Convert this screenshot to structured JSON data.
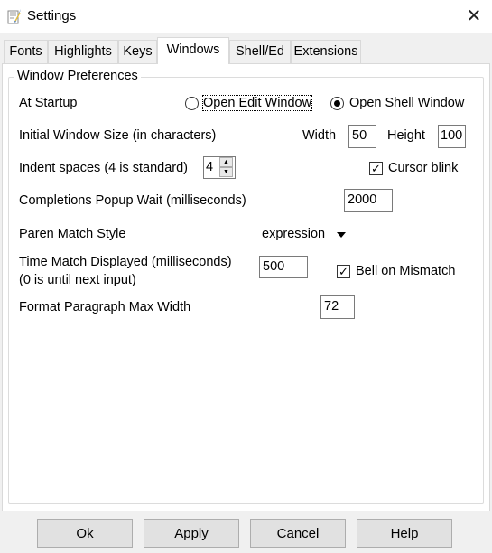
{
  "window": {
    "title": "Settings",
    "close_glyph": "✕",
    "icon": "python-feather-icon"
  },
  "tabs": [
    {
      "label": "Fonts"
    },
    {
      "label": "Highlights"
    },
    {
      "label": "Keys"
    },
    {
      "label": "Windows",
      "active": true
    },
    {
      "label": "Shell/Ed"
    },
    {
      "label": "Extensions"
    }
  ],
  "group": {
    "title": "Window Preferences",
    "startup": {
      "label": "At Startup",
      "option_edit": "Open Edit Window",
      "option_shell": "Open Shell Window",
      "selected": "Open Shell Window"
    },
    "window_size": {
      "label": "Initial Window Size  (in characters)",
      "width_label": "Width",
      "width_value": "50",
      "height_label": "Height",
      "height_value": "100"
    },
    "indent": {
      "label": "Indent spaces (4 is standard)",
      "value": "4",
      "up_glyph": "▲",
      "down_glyph": "▼"
    },
    "cursor_blink": {
      "label": "Cursor blink",
      "checked": true,
      "mark": "✓"
    },
    "completions": {
      "label": "Completions Popup Wait (milliseconds)",
      "value": "2000"
    },
    "paren": {
      "label": "Paren Match Style",
      "value": "expression"
    },
    "time_match": {
      "label_line1": "Time Match Displayed (milliseconds)",
      "label_line2": "(0 is until next input)",
      "value": "500"
    },
    "bell": {
      "label": "Bell on Mismatch",
      "checked": true,
      "mark": "✓"
    },
    "format_paragraph": {
      "label": "Format Paragraph Max Width",
      "value": "72"
    }
  },
  "buttons": {
    "ok": "Ok",
    "apply": "Apply",
    "cancel": "Cancel",
    "help": "Help"
  },
  "colors": {
    "window_bg": "#f0f0f0",
    "panel_bg": "#ffffff",
    "button_bg": "#e1e1e1",
    "border": "#adadad"
  }
}
